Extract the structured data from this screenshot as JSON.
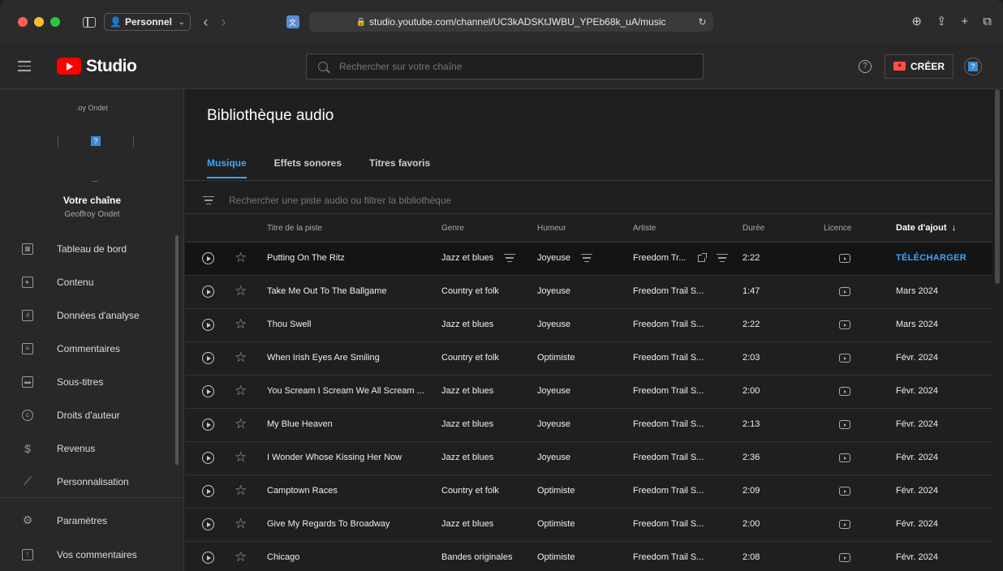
{
  "browser": {
    "profile": "Personnel",
    "url": "studio.youtube.com/channel/UC3kADSKtJWBU_YPEb68k_uA/music"
  },
  "header": {
    "logo_text": "Studio",
    "search_placeholder": "Rechercher sur votre chaîne",
    "create_label": "CRÉER"
  },
  "sidebar": {
    "channel_label": ".oy Ondet",
    "your_channel": "Votre chaîne",
    "channel_name": "Geoffroy Ondet",
    "items": [
      {
        "label": "Tableau de bord",
        "icon": "dashboard-icon"
      },
      {
        "label": "Contenu",
        "icon": "content-icon"
      },
      {
        "label": "Données d'analyse",
        "icon": "analytics-icon"
      },
      {
        "label": "Commentaires",
        "icon": "comments-icon"
      },
      {
        "label": "Sous-titres",
        "icon": "subtitles-icon"
      },
      {
        "label": "Droits d'auteur",
        "icon": "copyright-icon"
      },
      {
        "label": "Revenus",
        "icon": "dollar-icon"
      },
      {
        "label": "Personnalisation",
        "icon": "magic-wand-icon"
      }
    ],
    "bottom_items": [
      {
        "label": "Paramètres",
        "icon": "gear-icon"
      },
      {
        "label": "Vos commentaires",
        "icon": "feedback-icon"
      }
    ]
  },
  "main": {
    "title": "Bibliothèque audio",
    "tabs": [
      "Musique",
      "Effets sonores",
      "Titres favoris"
    ],
    "filter_placeholder": "Rechercher une piste audio ou filtrer la bibliothèque",
    "columns": {
      "title": "Titre de la piste",
      "genre": "Genre",
      "mood": "Humeur",
      "artist": "Artiste",
      "duration": "Durée",
      "license": "Licence",
      "date": "Date d'ajout",
      "sort_arrow": "↓"
    },
    "rows": [
      {
        "title": "Putting On The Ritz",
        "genre": "Jazz et blues",
        "mood": "Joyeuse",
        "artist": "Freedom Tr...",
        "duration": "2:22",
        "date": "TÉLÉCHARGER"
      },
      {
        "title": "Take Me Out To The Ballgame",
        "genre": "Country et folk",
        "mood": "Joyeuse",
        "artist": "Freedom Trail S...",
        "duration": "1:47",
        "date": "Mars 2024"
      },
      {
        "title": "Thou Swell",
        "genre": "Jazz et blues",
        "mood": "Joyeuse",
        "artist": "Freedom Trail S...",
        "duration": "2:22",
        "date": "Mars 2024"
      },
      {
        "title": "When Irish Eyes Are Smiling",
        "genre": "Country et folk",
        "mood": "Optimiste",
        "artist": "Freedom Trail S...",
        "duration": "2:03",
        "date": "Févr. 2024"
      },
      {
        "title": "You Scream I Scream We All Scream ...",
        "genre": "Jazz et blues",
        "mood": "Joyeuse",
        "artist": "Freedom Trail S...",
        "duration": "2:00",
        "date": "Févr. 2024"
      },
      {
        "title": "My Blue Heaven",
        "genre": "Jazz et blues",
        "mood": "Joyeuse",
        "artist": "Freedom Trail S...",
        "duration": "2:13",
        "date": "Févr. 2024"
      },
      {
        "title": "I Wonder Whose Kissing Her Now",
        "genre": "Jazz et blues",
        "mood": "Joyeuse",
        "artist": "Freedom Trail S...",
        "duration": "2:36",
        "date": "Févr. 2024"
      },
      {
        "title": "Camptown Races",
        "genre": "Country et folk",
        "mood": "Optimiste",
        "artist": "Freedom Trail S...",
        "duration": "2:09",
        "date": "Févr. 2024"
      },
      {
        "title": "Give My Regards To Broadway",
        "genre": "Jazz et blues",
        "mood": "Optimiste",
        "artist": "Freedom Trail S...",
        "duration": "2:00",
        "date": "Févr. 2024"
      },
      {
        "title": "Chicago",
        "genre": "Bandes originales",
        "mood": "Optimiste",
        "artist": "Freedom Trail S...",
        "duration": "2:08",
        "date": "Févr. 2024"
      }
    ]
  },
  "colors": {
    "accent": "#3ea6ff",
    "brand_red": "#ff0000",
    "background": "#1f1f1f",
    "panel": "#282828"
  }
}
